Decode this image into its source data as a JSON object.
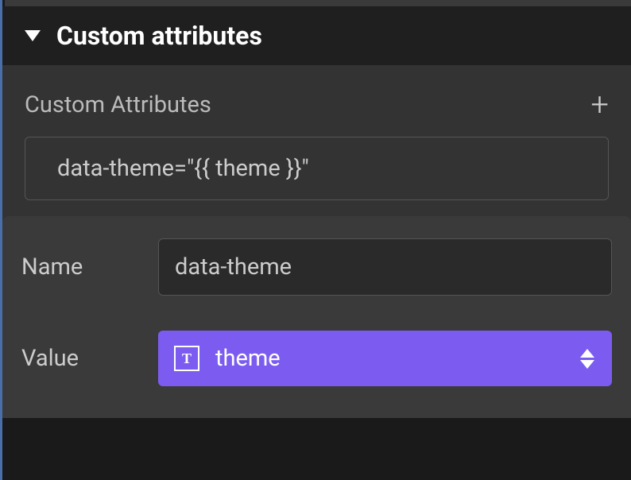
{
  "header": {
    "title": "Custom attributes"
  },
  "subsection": {
    "title": "Custom Attributes",
    "attribute_display": "data-theme=\"{{ theme }}\""
  },
  "form": {
    "name_label": "Name",
    "name_value": "data-theme",
    "value_label": "Value",
    "value_text": "theme",
    "type_icon_letter": "T"
  },
  "colors": {
    "accent": "#7c5cf0"
  }
}
